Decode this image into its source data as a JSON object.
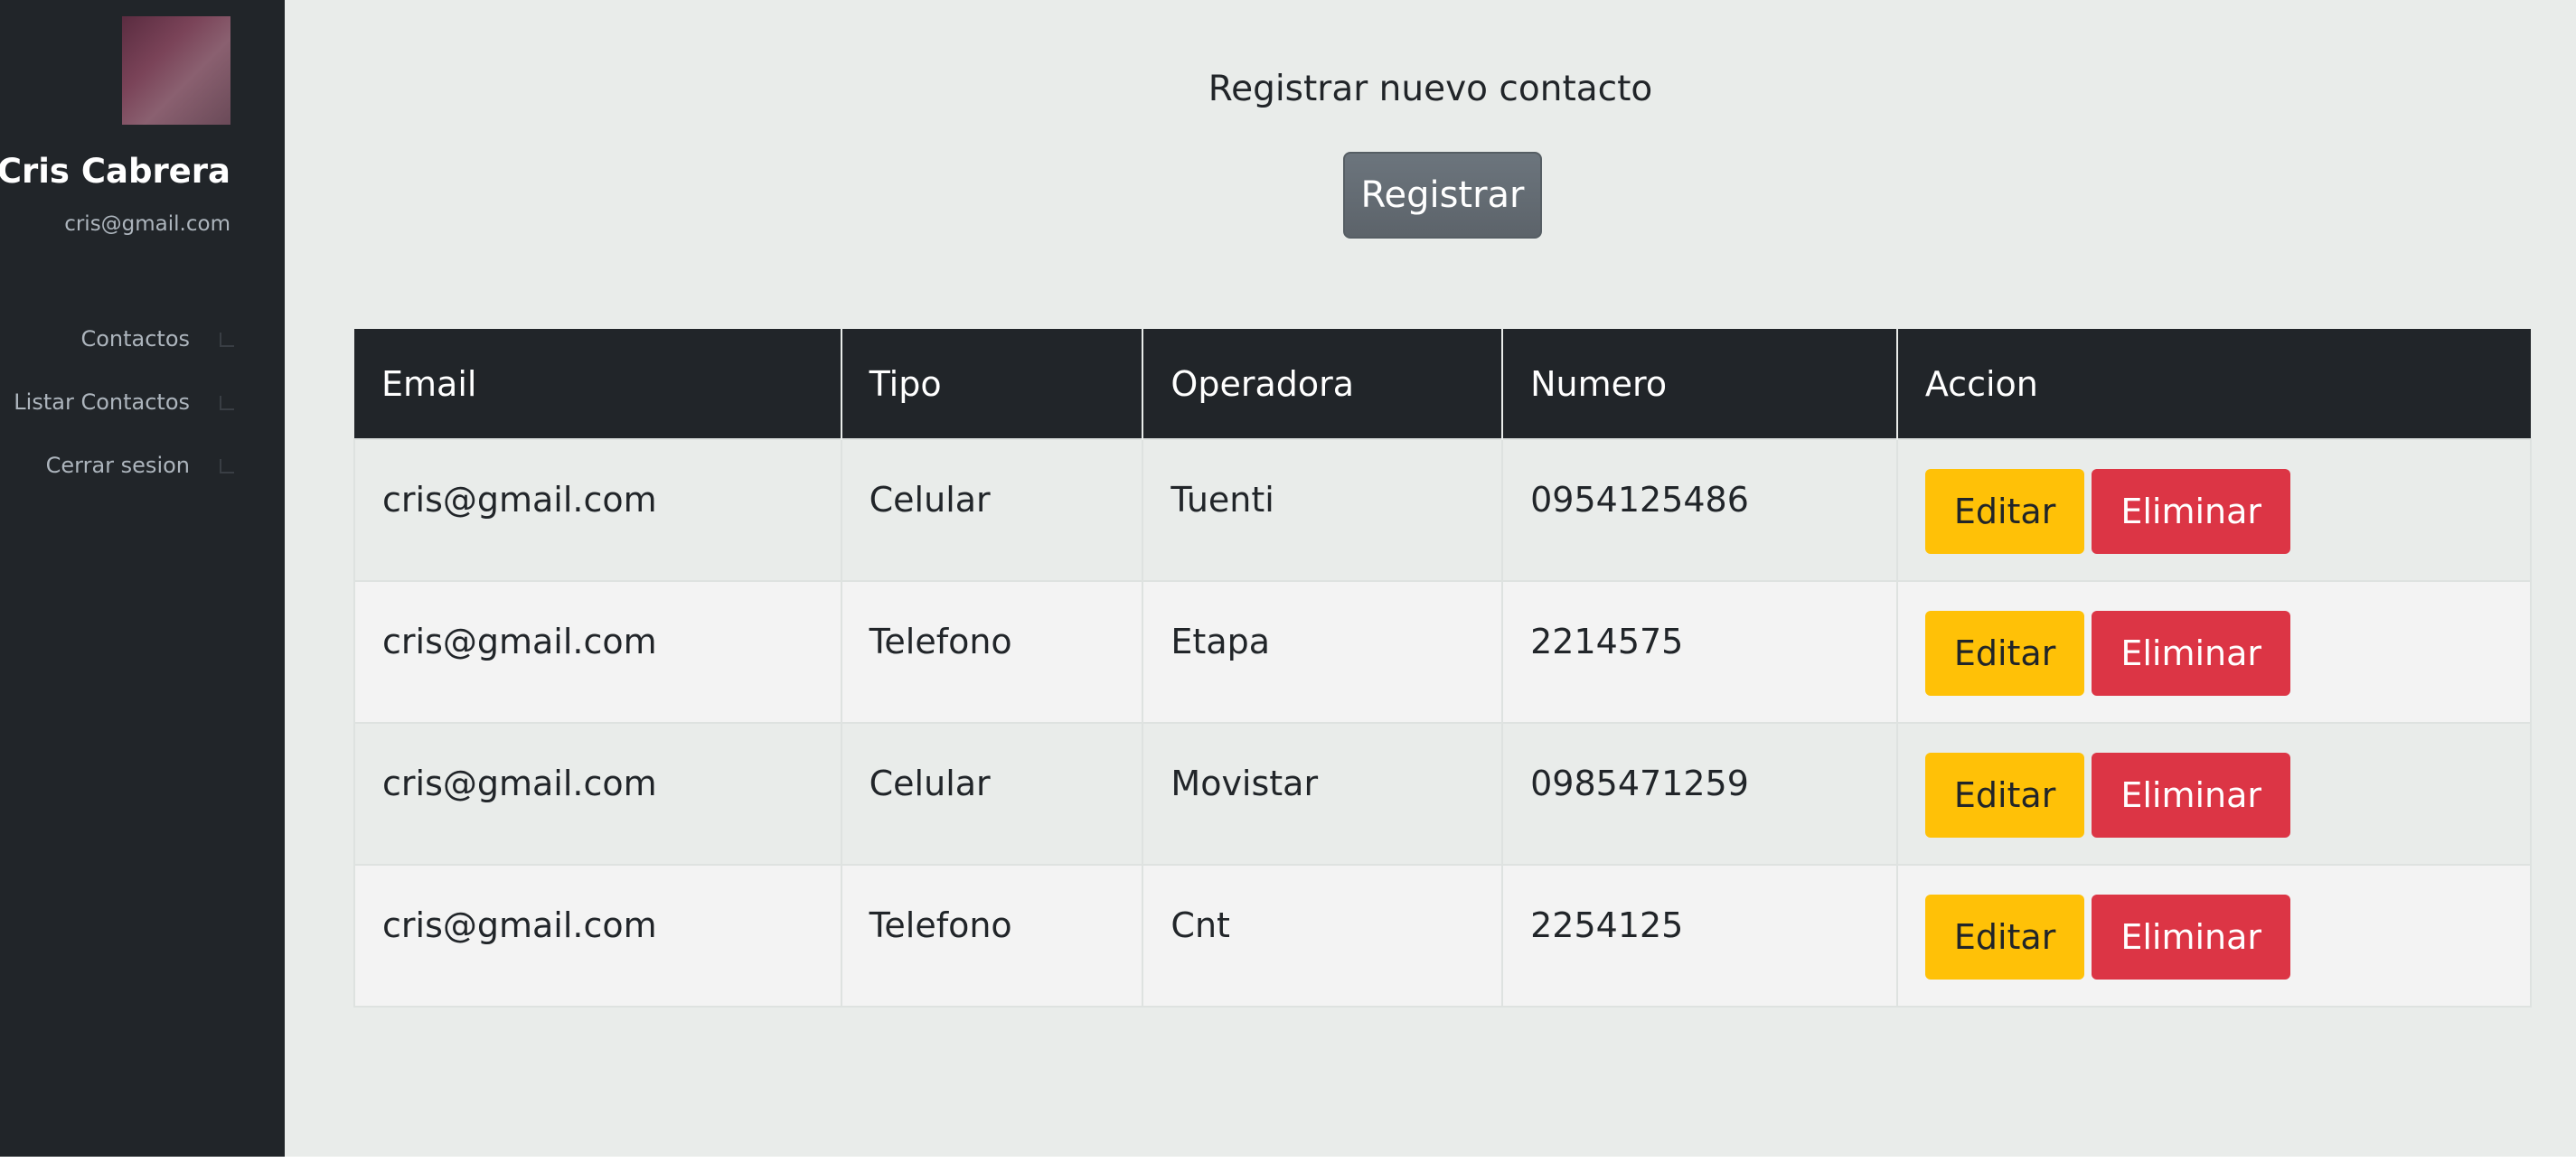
{
  "sidebar": {
    "user_name": "Cris Cabrera",
    "user_email": "cris@gmail.com",
    "nav_items": [
      {
        "label": "Contactos",
        "icon": "arrow-icon"
      },
      {
        "label": "Listar Contactos",
        "icon": "arrow-icon"
      },
      {
        "label": "Cerrar sesion",
        "icon": "arrow-icon"
      }
    ]
  },
  "main": {
    "register_title": "Registrar nuevo contacto",
    "register_button": "Registrar"
  },
  "table": {
    "headers": [
      "Email",
      "Tipo",
      "Operadora",
      "Numero",
      "Accion"
    ],
    "rows": [
      {
        "email": "cris@gmail.com",
        "tipo": "Celular",
        "operadora": "Tuenti",
        "numero": "0954125486"
      },
      {
        "email": "cris@gmail.com",
        "tipo": "Telefono",
        "operadora": "Etapa",
        "numero": "2214575"
      },
      {
        "email": "cris@gmail.com",
        "tipo": "Celular",
        "operadora": "Movistar",
        "numero": "0985471259"
      },
      {
        "email": "cris@gmail.com",
        "tipo": "Telefono",
        "operadora": "Cnt",
        "numero": "2254125"
      }
    ],
    "edit_label": "Editar",
    "delete_label": "Eliminar"
  },
  "colors": {
    "sidebar_bg": "#212529",
    "main_bg": "#e9ecea",
    "register_button": "#6c757d",
    "edit_button": "#ffc107",
    "delete_button": "#dc3545"
  }
}
